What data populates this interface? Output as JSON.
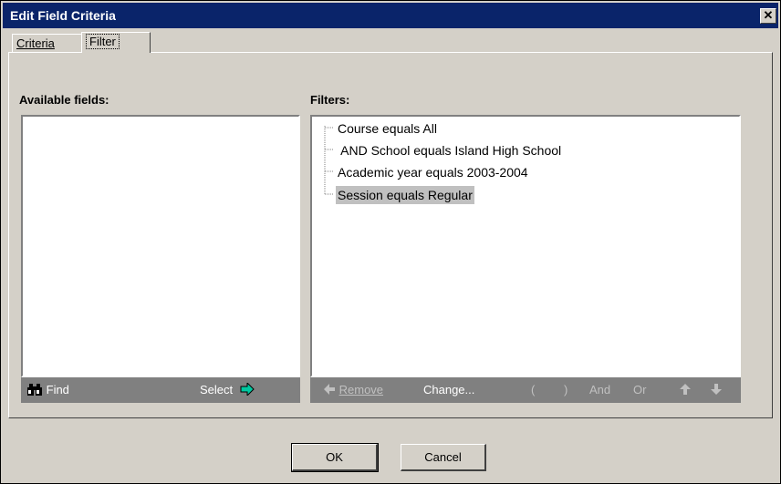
{
  "window": {
    "title": "Edit Field Criteria",
    "close_glyph": "✕"
  },
  "tabs": [
    {
      "label": "Criteria",
      "active": false
    },
    {
      "label": "Filter",
      "active": true
    }
  ],
  "available": {
    "label": "Available fields:",
    "items": [],
    "toolbar": {
      "find": "Find",
      "select": "Select"
    }
  },
  "filters": {
    "label": "Filters:",
    "items": [
      {
        "text": "Course equals All",
        "selected": false
      },
      {
        "text": " AND School equals Island High School",
        "selected": false
      },
      {
        "text": "Academic year equals 2003-2004",
        "selected": false
      },
      {
        "text": "Session equals Regular",
        "selected": true
      }
    ],
    "toolbar": {
      "remove": "Remove",
      "change": "Change...",
      "open_paren": "(",
      "close_paren": ")",
      "and": "And",
      "or": "Or"
    }
  },
  "buttons": {
    "ok": "OK",
    "cancel": "Cancel"
  },
  "colors": {
    "titlebar": "#0a246a",
    "arrow": "#00c8a0",
    "face": "#d4d0c8",
    "toolbar": "#808080"
  }
}
